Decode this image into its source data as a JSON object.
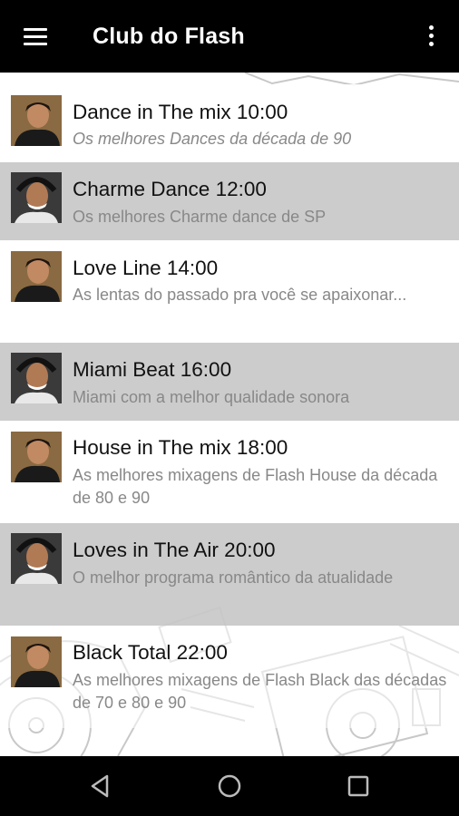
{
  "appbar": {
    "title": "Club do Flash",
    "menu_icon": "hamburger-menu-icon",
    "overflow_icon": "more-vert-icon"
  },
  "programs": [
    {
      "title": "Dance in The mix 10:00",
      "subtitle": "Os melhores Dances da década de 90",
      "host": "host-a"
    },
    {
      "title": "Charme Dance 12:00",
      "subtitle": "Os melhores Charme dance de SP",
      "host": "host-b"
    },
    {
      "title": "Love Line 14:00",
      "subtitle": "As lentas do passado pra você se apaixonar...",
      "host": "host-a"
    },
    {
      "title": "Miami Beat 16:00",
      "subtitle": "Miami com a melhor qualidade sonora",
      "host": "host-b"
    },
    {
      "title": "House in The mix 18:00",
      "subtitle": "As melhores mixagens de Flash House da década de 80 e 90",
      "host": "host-a"
    },
    {
      "title": "Loves in The Air 20:00",
      "subtitle": "O melhor programa romântico da atualidade",
      "host": "host-b"
    },
    {
      "title": "Black Total 22:00",
      "subtitle": "As melhores mixagens de Flash Black das décadas de 70 e 80 e 90",
      "host": "host-a"
    }
  ],
  "navbar": {
    "back_icon": "back-triangle-icon",
    "home_icon": "home-circle-icon",
    "recents_icon": "recents-square-icon"
  }
}
